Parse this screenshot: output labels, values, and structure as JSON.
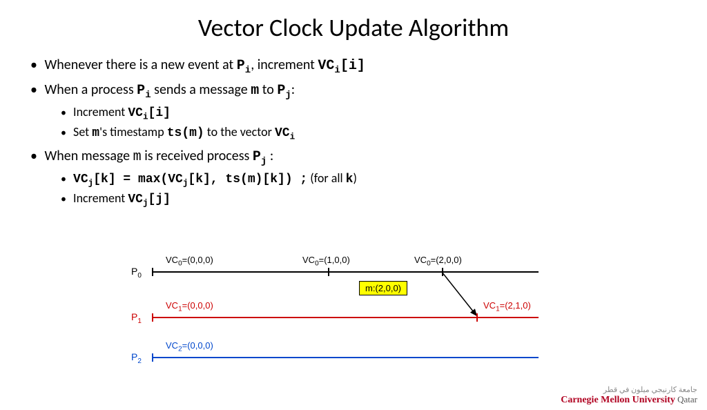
{
  "title": "Vector Clock Update Algorithm",
  "bullets": {
    "b1_pre": "Whenever there is a new event at ",
    "b1_p": "P",
    "b1_i": "i",
    "b1_mid": ", increment ",
    "b1_vc": "VC",
    "b1_idx": "i",
    "b1_bracket": "[i]",
    "b2_pre": "When a process ",
    "b2_p": "P",
    "b2_i": "i",
    "b2_mid": " sends a message ",
    "b2_m": "m",
    "b2_to": " to ",
    "b2_pj": "P",
    "b2_j": "j",
    "b2_colon": ":",
    "b2a_pre": "Increment  ",
    "b2a_vc": "VC",
    "b2a_i": "i",
    "b2a_bracket": "[i]",
    "b2b_pre": "Set ",
    "b2b_m": "m",
    "b2b_mid": "'s timestamp ",
    "b2b_ts": "ts(m)",
    "b2b_to": " to the vector ",
    "b2b_vc": "VC",
    "b2b_i": "i",
    "b3_pre": "When message ",
    "b3_m": "m",
    "b3_mid": " is received process ",
    "b3_p": "P",
    "b3_j": "j",
    "b3_colon": " :",
    "b3a_vc": "VC",
    "b3a_j": "j",
    "b3a_expr": "[k] = max(VC",
    "b3a_j2": "j",
    "b3a_rest": "[k], ts(m)[k]) ;",
    "b3a_forall": "   (for all ",
    "b3a_k": "k",
    "b3a_close": ")",
    "b3b_pre": "Increment ",
    "b3b_vc": "VC",
    "b3b_j": "j",
    "b3b_bracket": "[j]"
  },
  "diagram": {
    "p0": "P",
    "p0sub": "0",
    "p1": "P",
    "p1sub": "1",
    "p2": "P",
    "p2sub": "2",
    "vc00": "VC",
    "vc00sub": "0",
    "vc00val": "=(0,0,0)",
    "vc01": "VC",
    "vc01sub": "0",
    "vc01val": "=(1,0,0)",
    "vc02": "VC",
    "vc02sub": "0",
    "vc02val": "=(2,0,0)",
    "vc10": "VC",
    "vc10sub": "1",
    "vc10val": "=(0,0,0)",
    "vc11": "VC",
    "vc11sub": "1",
    "vc11val": "=(2,1,0)",
    "vc20": "VC",
    "vc20sub": "2",
    "vc20val": "=(0,0,0)",
    "msg": "m:(2,0,0)"
  },
  "footer": {
    "line1": "جامعة كارنيجي ميلون في قطر",
    "line2": "Carnegie Mellon University",
    "qatar": " Qatar"
  },
  "colors": {
    "p0": "#000000",
    "p1": "#cc0000",
    "p2": "#0047cc"
  }
}
